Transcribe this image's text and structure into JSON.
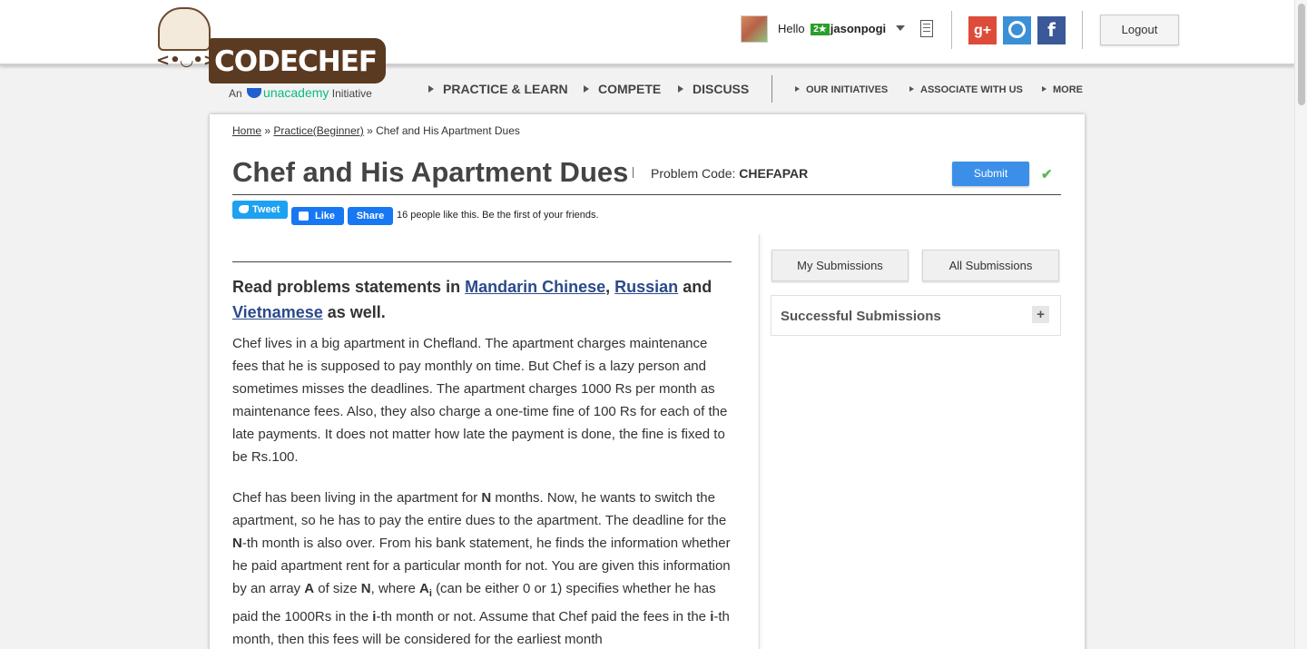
{
  "brand": {
    "wordmark": "CODECHEF",
    "initiative_prefix": "An",
    "initiative_brand": "unacademy",
    "initiative_suffix": "Initiative"
  },
  "user": {
    "greeting": "Hello",
    "stars": "2★",
    "username": "jasonpogi"
  },
  "header": {
    "logout_label": "Logout",
    "social": [
      "g+",
      "github",
      "f"
    ]
  },
  "nav": {
    "primary": [
      "PRACTICE & LEARN",
      "COMPETE",
      "DISCUSS"
    ],
    "secondary": [
      "OUR INITIATIVES",
      "ASSOCIATE WITH US",
      "MORE"
    ]
  },
  "breadcrumb": {
    "home": "Home",
    "sep1": "»",
    "practice": "Practice(Beginner)",
    "sep2": "»",
    "current": "Chef and His Apartment Dues"
  },
  "problem": {
    "title": "Chef and His Apartment Dues",
    "code_label": "Problem Code:",
    "code": "CHEFAPAR",
    "submit_label": "Submit",
    "check": "✔"
  },
  "sharing": {
    "tweet_label": "Tweet",
    "like_label": "Like",
    "share_label": "Share",
    "like_text": "16 people like this. Be the first of your friends."
  },
  "statement": {
    "read_prefix": "Read problems statements in",
    "lang1": "Mandarin Chinese",
    "lang2": "Russian",
    "and": "and",
    "lang3": "Vietnamese",
    "read_suffix": "as well.",
    "para1": "Chef lives in a big apartment in Chefland. The apartment charges maintenance fees that he is supposed to pay monthly on time. But Chef is a lazy person and sometimes misses the deadlines. The apartment charges 1000 Rs per month as maintenance fees. Also, they also charge a one-time fine of 100 Rs for each of the late payments. It does not matter how late the payment is done, the fine is fixed to be Rs.100.",
    "p2_a": "Chef has been living in the apartment for",
    "p2_N1": "N",
    "p2_b": "months. Now, he wants to switch the apartment, so he has to pay the entire dues to the apartment. The deadline for the",
    "p2_N2": "N",
    "p2_c": "-th month is also over. From his bank statement, he finds the information whether he paid apartment rent for a particular month for not. You are given this information by an array",
    "p2_A": "A",
    "p2_d": "of size",
    "p2_N3": "N",
    "p2_e": ", where",
    "p2_Ai": "A",
    "p2_sub": "i",
    "p2_f": "(can be either 0 or 1) specifies whether he has paid the 1000Rs in the",
    "p2_i1": "i",
    "p2_g": "-th month or not. Assume that Chef paid the fees in the",
    "p2_i2": "i",
    "p2_h": "-th month, then this fees will be considered for the earliest month"
  },
  "sidebar": {
    "my_submissions": "My Submissions",
    "all_submissions": "All Submissions",
    "successful_submissions": "Successful Submissions",
    "expand": "+"
  }
}
